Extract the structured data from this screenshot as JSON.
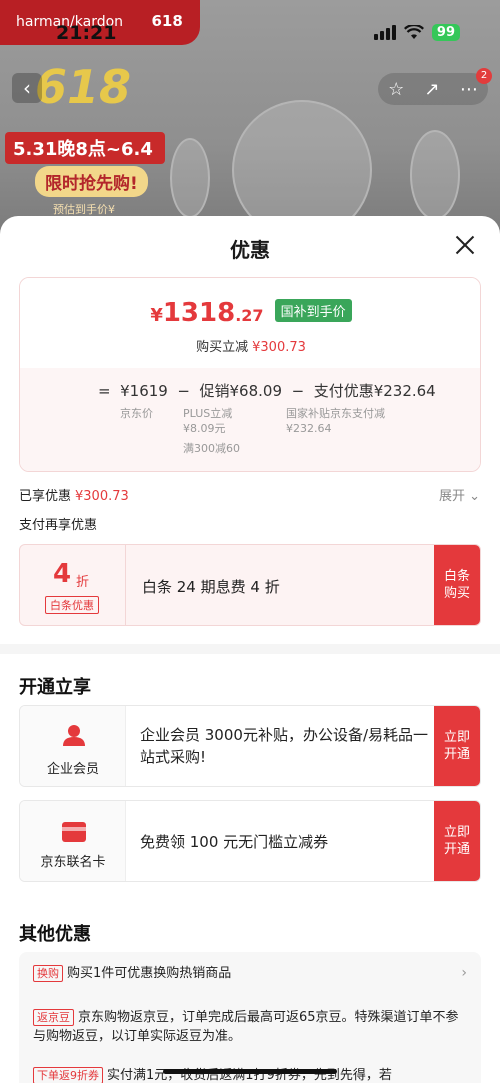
{
  "status": {
    "time": "21:21",
    "battery": "99"
  },
  "header": {
    "brand": "harman/kardon",
    "brand_sub": "618",
    "notif_count": "2"
  },
  "promo": {
    "big": "618",
    "date": "5.31晚8点~6.4",
    "rush": "限时抢先购!",
    "est": "预估到手价¥"
  },
  "sheet": {
    "title": "优惠",
    "price": {
      "symbol": "¥",
      "integer": "1318",
      "decimal": ".27",
      "tag": "国补到手价"
    },
    "reduce": {
      "label": "购买立减",
      "value": "¥300.73"
    },
    "formula": {
      "eq": "=",
      "base": "¥1619",
      "minus1": "−",
      "promo": "促销¥68.09",
      "minus2": "−",
      "pay": "支付优惠¥232.64",
      "base_label": "京东价",
      "promo_sub1": "PLUS立减",
      "promo_sub2": "¥8.09元",
      "promo_sub3": "满300减60",
      "pay_sub1": "国家补贴京东支付减",
      "pay_sub2": "¥232.64"
    },
    "enjoyed": {
      "label": "已享优惠",
      "value": "¥300.73",
      "expand": "展开"
    },
    "pay_extra": "支付再享优惠",
    "baitiao": {
      "num": "4",
      "zhe": "折",
      "tag": "白条优惠",
      "text": "白条 24 期息费 4 折",
      "btn_l1": "白条",
      "btn_l2": "购买"
    },
    "open_section": {
      "title": "开通立享",
      "items": [
        {
          "label": "企业会员",
          "text": "企业会员 3000元补贴，办公设备/易耗品一站式采购!",
          "btn_l1": "立即",
          "btn_l2": "开通"
        },
        {
          "label": "京东联名卡",
          "text": "免费领 100 元无门槛立减券",
          "btn_l1": "立即",
          "btn_l2": "开通"
        }
      ]
    },
    "other_section": {
      "title": "其他优惠",
      "items": [
        {
          "tag": "换购",
          "text": "购买1件可优惠换购热销商品"
        },
        {
          "tag": "返京豆",
          "text": "京东购物返京豆，订单完成后最高可返65京豆。特殊渠道订单不参与购物返豆，以订单实际返豆为准。"
        },
        {
          "tag": "下单返9折券",
          "text": "实付满1元，收货后返满1打9折券，先到先得，若"
        }
      ]
    }
  },
  "colors": {
    "accent": "#e4393c",
    "gov_green": "#3aa65a"
  }
}
